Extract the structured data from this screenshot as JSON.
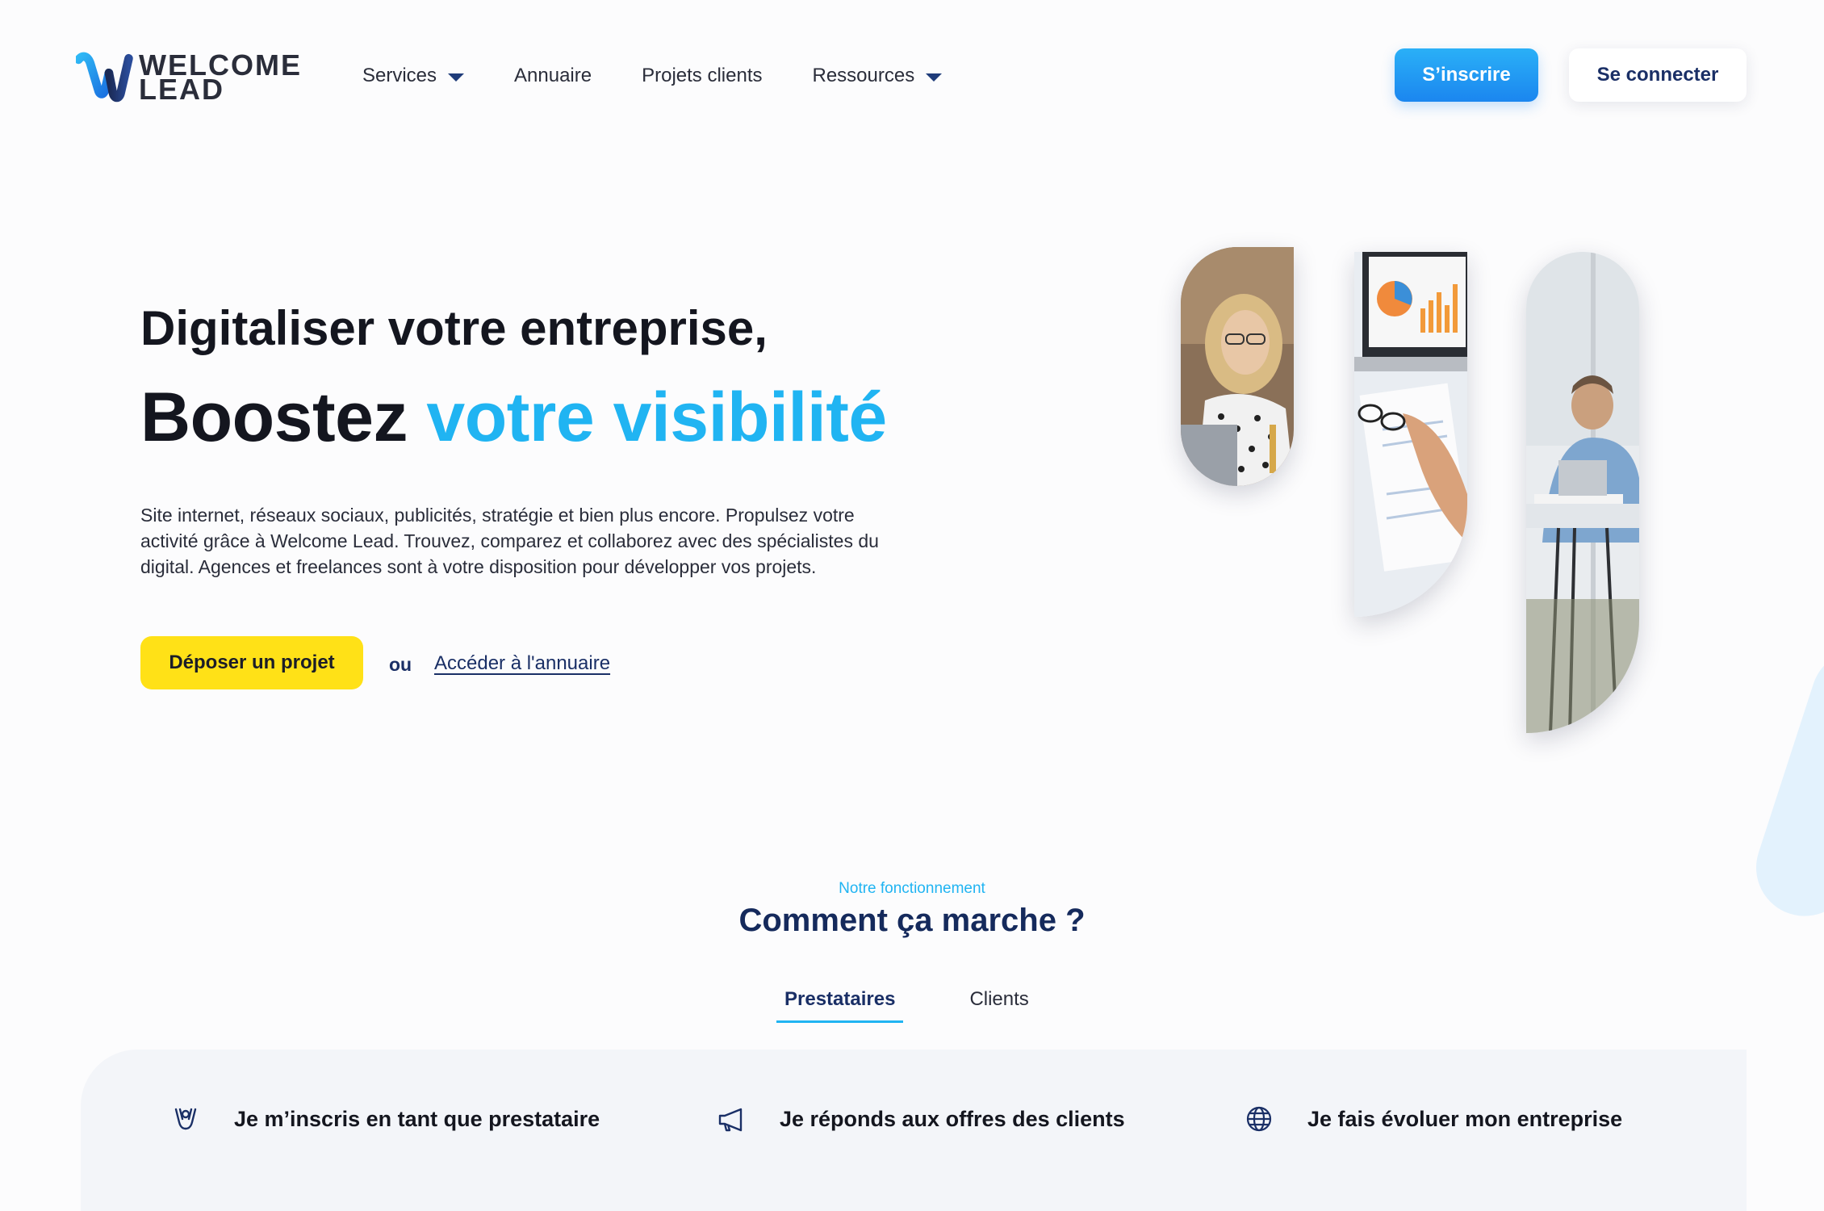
{
  "brand": {
    "logo_line1": "WELCOME",
    "logo_line2": "LEAD",
    "accent_color": "#20b4f2",
    "navy_color": "#1a2f66",
    "yellow_color": "#ffe117"
  },
  "nav": {
    "items": [
      {
        "label": "Services",
        "dropdown": true
      },
      {
        "label": "Annuaire",
        "dropdown": false
      },
      {
        "label": "Projets clients",
        "dropdown": false
      },
      {
        "label": "Ressources",
        "dropdown": true
      }
    ],
    "signup_label": "S’inscrire",
    "login_label": "Se connecter"
  },
  "hero": {
    "line1": "Digitaliser votre entreprise,",
    "line2_plain": "Boostez",
    "line2_accent": "votre visibilité",
    "description": "Site internet, réseaux sociaux, publicités, stratégie et bien plus encore. Propulsez votre activité grâce à Welcome Lead. Trouvez, comparez et collaborez avec des spécialistes du digital. Agences et freelances sont à votre disposition pour développer vos projets.",
    "cta_project": "Déposer un projet",
    "or_text": "ou",
    "cta_directory": "Accéder à l'annuaire"
  },
  "how_it_works": {
    "eyebrow": "Notre fonctionnement",
    "title": "Comment ça marche ?",
    "tabs": [
      {
        "label": "Prestataires",
        "active": true
      },
      {
        "label": "Clients",
        "active": false
      }
    ],
    "steps": [
      {
        "icon": "raised-hands-icon",
        "label": "Je m’inscris en tant que prestataire"
      },
      {
        "icon": "megaphone-icon",
        "label": "Je réponds aux offres des clients"
      },
      {
        "icon": "globe-icon",
        "label": "Je fais évoluer mon entreprise"
      }
    ]
  }
}
